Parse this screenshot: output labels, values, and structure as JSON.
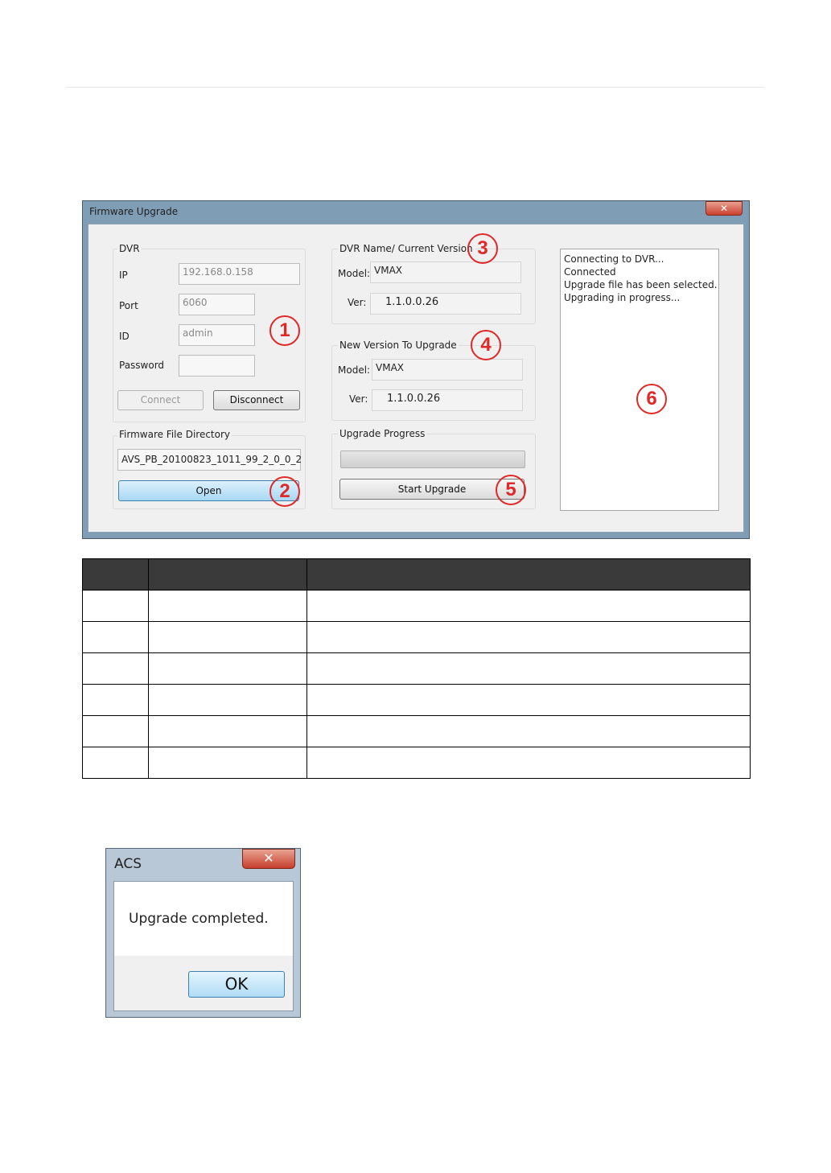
{
  "window": {
    "title": "Firmware Upgrade",
    "close_icon": "✕",
    "dvr": {
      "group_label": "DVR",
      "ip_label": "IP",
      "ip_value": "192.168.0.158",
      "port_label": "Port",
      "port_value": "6060",
      "id_label": "ID",
      "id_value": "admin",
      "password_label": "Password",
      "password_value": "",
      "connect_label": "Connect",
      "disconnect_label": "Disconnect"
    },
    "firmware": {
      "group_label": "Firmware File Directory",
      "file_value": "AVS_PB_20100823_1011_99_2_0_0_2",
      "open_label": "Open"
    },
    "current": {
      "group_label": "DVR Name/ Current Version",
      "model_label": "Model:",
      "model_value": "VMAX",
      "ver_label": "Ver:",
      "ver_value": "1.1.0.0.26"
    },
    "newver": {
      "group_label": "New Version To Upgrade",
      "model_label": "Model:",
      "model_value": "VMAX",
      "ver_label": "Ver:",
      "ver_value": "1.1.0.0.26"
    },
    "progress": {
      "group_label": "Upgrade Progress",
      "percent": 0,
      "start_label": "Start Upgrade"
    },
    "log": [
      "Connecting to DVR...",
      "Connected",
      "Upgrade file has been selected.",
      "Upgrading in progress..."
    ]
  },
  "callouts": [
    "1",
    "2",
    "3",
    "4",
    "5",
    "6"
  ],
  "legend_table": {
    "header": [
      "",
      "",
      ""
    ],
    "rows": [
      [
        "",
        "",
        ""
      ],
      [
        "",
        "",
        ""
      ],
      [
        "",
        "",
        ""
      ],
      [
        "",
        "",
        ""
      ],
      [
        "",
        "",
        ""
      ],
      [
        "",
        "",
        ""
      ]
    ]
  },
  "dialog": {
    "title": "ACS",
    "close_icon": "✕",
    "message": "Upgrade completed.",
    "ok_label": "OK"
  },
  "colors": {
    "callout": "#e02828",
    "table_header": "#3a3a3a",
    "title_bar": "#7f9db5"
  }
}
